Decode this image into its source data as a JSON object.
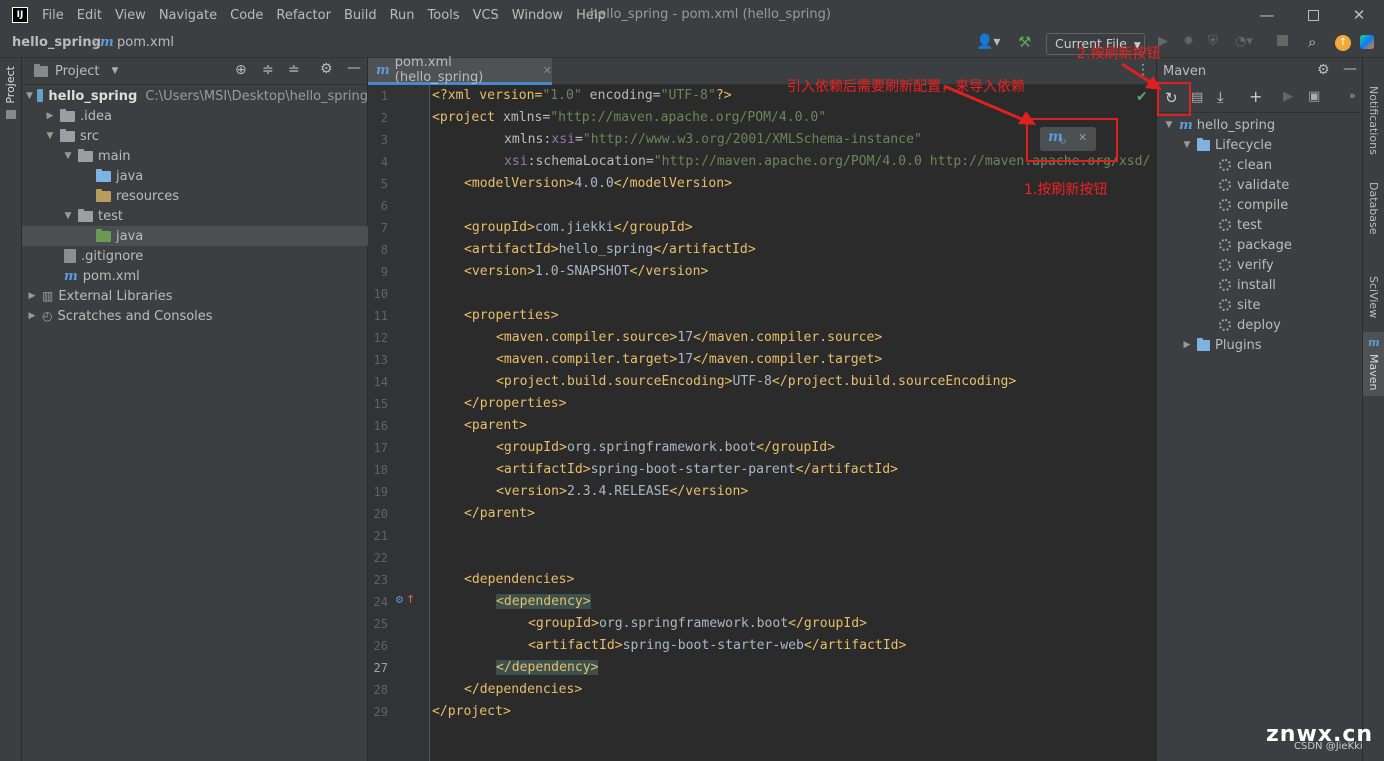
{
  "window": {
    "title": "hello_spring - pom.xml (hello_spring)",
    "app_icon_text": "IJ"
  },
  "menu": [
    "File",
    "Edit",
    "View",
    "Navigate",
    "Code",
    "Refactor",
    "Build",
    "Run",
    "Tools",
    "VCS",
    "Window",
    "Help"
  ],
  "navbar": {
    "project": "hello_spring",
    "file": "pom.xml",
    "run_config": "Current File"
  },
  "left_stripe": {
    "label": "Project"
  },
  "project_panel": {
    "title": "Project",
    "items": [
      {
        "label": "hello_spring",
        "path": "C:\\Users\\MSI\\Desktop\\hello_spring"
      },
      {
        "label": ".idea"
      },
      {
        "label": "src"
      },
      {
        "label": "main"
      },
      {
        "label": "java"
      },
      {
        "label": "resources"
      },
      {
        "label": "test"
      },
      {
        "label": "java"
      },
      {
        "label": ".gitignore"
      },
      {
        "label": "pom.xml"
      },
      {
        "label": "External Libraries"
      },
      {
        "label": "Scratches and Consoles"
      }
    ]
  },
  "editor": {
    "tab_label": "pom.xml (hello_spring)",
    "line_numbers": [
      "1",
      "2",
      "3",
      "4",
      "5",
      "6",
      "7",
      "8",
      "9",
      "10",
      "11",
      "12",
      "13",
      "14",
      "15",
      "16",
      "17",
      "18",
      "19",
      "20",
      "21",
      "22",
      "23",
      "24",
      "25",
      "26",
      "27",
      "28",
      "29"
    ]
  },
  "code": {
    "l1": {
      "a": "<?xml version=",
      "b": "\"1.0\"",
      "c": " encoding=",
      "d": "\"UTF-8\"",
      "e": "?>"
    },
    "l2": {
      "a": "<project",
      "b": " xmlns=",
      "c": "\"http://maven.apache.org/POM/4.0.0\""
    },
    "l3": {
      "a": "xmlns:",
      "b": "xsi",
      "c": "=",
      "d": "\"http://www.w3.org/2001/XMLSchema-instance\""
    },
    "l4": {
      "a": "xsi",
      "b": ":schemaLocation=",
      "c": "\"http://maven.apache.org/POM/4.0.0 http://maven.apache.org/xsd/"
    },
    "l5": {
      "a": "<modelVersion>",
      "b": "4.0.0",
      "c": "</modelVersion>"
    },
    "l7": {
      "a": "<groupId>",
      "b": "com.jiekki",
      "c": "</groupId>"
    },
    "l8": {
      "a": "<artifactId>",
      "b": "hello_spring",
      "c": "</artifactId>"
    },
    "l9": {
      "a": "<version>",
      "b": "1.0-SNAPSHOT",
      "c": "</version>"
    },
    "l11": "<properties>",
    "l12": {
      "a": "<maven.compiler.source>",
      "b": "17",
      "c": "</maven.compiler.source>"
    },
    "l13": {
      "a": "<maven.compiler.target>",
      "b": "17",
      "c": "</maven.compiler.target>"
    },
    "l14": {
      "a": "<project.build.sourceEncoding>",
      "b": "UTF-8",
      "c": "</project.build.sourceEncoding>"
    },
    "l15": "</properties>",
    "l16": "<parent>",
    "l17": {
      "a": "<groupId>",
      "b": "org.springframework.boot",
      "c": "</groupId>"
    },
    "l18": {
      "a": "<artifactId>",
      "b": "spring-boot-starter-parent",
      "c": "</artifactId>"
    },
    "l19": {
      "a": "<version>",
      "b": "2.3.4.RELEASE",
      "c": "</version>"
    },
    "l20": "</parent>",
    "l23": "<dependencies>",
    "l24": "<dependency>",
    "l25": {
      "a": "<groupId>",
      "b": "org.springframework.boot",
      "c": "</groupId>"
    },
    "l26": {
      "a": "<artifactId>",
      "b": "spring-boot-starter-web",
      "c": "</artifactId>"
    },
    "l27": "</dependency>",
    "l28": "</dependencies>",
    "l29": "</project>"
  },
  "maven_panel": {
    "title": "Maven",
    "root": "hello_spring",
    "lifecycle": "Lifecycle",
    "goals": [
      "clean",
      "validate",
      "compile",
      "test",
      "package",
      "verify",
      "install",
      "site",
      "deploy"
    ],
    "plugins": "Plugins"
  },
  "right_stripe": [
    "Notifications",
    "Database",
    "SciView",
    "Maven"
  ],
  "annotations": {
    "top_note": "引入依赖后需要刷新配置，来导入依赖",
    "step1": "1.按刷新按钮",
    "step2": "2.按刷新按钮"
  },
  "watermark": {
    "site": "znwx.cn",
    "credit": "CSDN @JieKki"
  },
  "colors": {
    "accent": "#4a88c7",
    "annotation_red": "#e02020",
    "maven_blue": "#5e9bd5",
    "folder_blue": "#6aa0c8",
    "source_folder": "#7eb3e0",
    "test_folder": "#6a9a55",
    "resources_folder": "#b89d5b"
  }
}
